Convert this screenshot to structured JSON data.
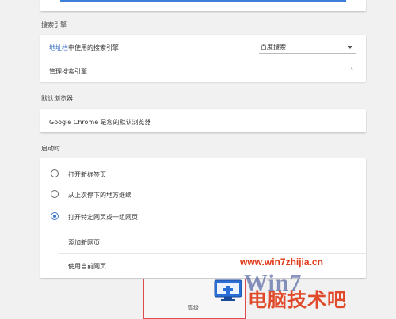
{
  "search_engine": {
    "section_title": "搜索引擎",
    "address_bar_label_link": "地址栏",
    "address_bar_label_rest": "中使用的搜索引擎",
    "selected_engine": "百度搜索",
    "manage_label": "管理搜索引擎"
  },
  "default_browser": {
    "section_title": "默认浏览器",
    "status_text": "Google Chrome 是您的默认浏览器"
  },
  "on_startup": {
    "section_title": "启动时",
    "options": [
      {
        "label": "打开新标签页",
        "checked": false
      },
      {
        "label": "从上次停下的地方继续",
        "checked": false
      },
      {
        "label": "打开特定网页或一组网页",
        "checked": true
      }
    ],
    "add_page_link": "添加新网页",
    "use_current_link": "使用当前网页"
  },
  "advanced_label": "高级",
  "watermark": {
    "url": "www.win7zhijia.cn",
    "logo_text": "Win7",
    "site_name": "电脑技术吧"
  },
  "colors": {
    "accent": "#3b73c9",
    "highlight_border": "#e04b4b",
    "watermark_red": "#e03b1a"
  }
}
